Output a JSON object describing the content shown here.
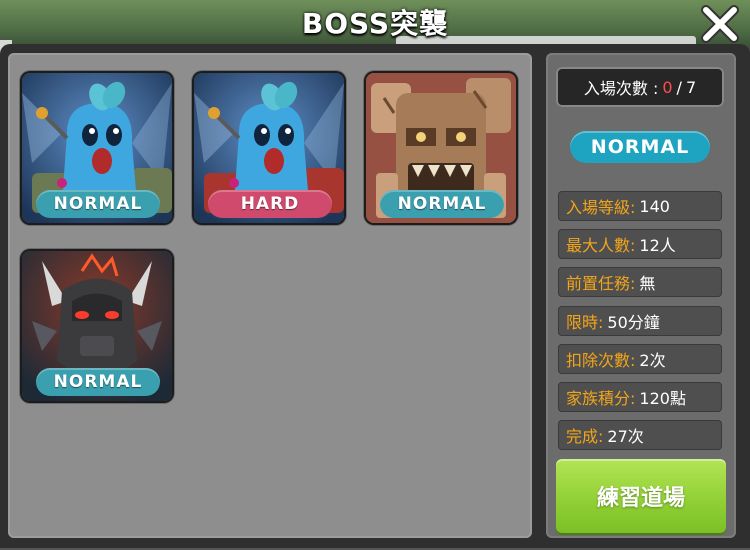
{
  "dialog": {
    "title": "BOSS突襲"
  },
  "bosses": [
    {
      "name_icon": "blue-sprout-boss-icon",
      "difficulty": "NORMAL",
      "badge_color": "#3a9fae"
    },
    {
      "name_icon": "blue-sprout-boss-icon",
      "difficulty": "HARD",
      "badge_color": "#cf4a6c"
    },
    {
      "name_icon": "stone-golem-boss-icon",
      "difficulty": "NORMAL",
      "badge_color": "#3a9fae"
    },
    {
      "name_icon": "dark-horned-beast-boss-icon",
      "difficulty": "NORMAL",
      "badge_color": "#3a9fae"
    }
  ],
  "info": {
    "entry_label": "入場次數 :",
    "entry_current": "0",
    "entry_sep": "/",
    "entry_max": "7",
    "selected_difficulty": "NORMAL",
    "stats": [
      {
        "label": "入場等級:",
        "value": "140"
      },
      {
        "label": "最大人數:",
        "value": "12人"
      },
      {
        "label": "前置任務:",
        "value": "無"
      },
      {
        "label": "限時:",
        "value": "50分鐘"
      },
      {
        "label": "扣除次數:",
        "value": "2次"
      },
      {
        "label": "家族積分:",
        "value": "120點"
      },
      {
        "label": "完成:",
        "value": "27次"
      }
    ],
    "practice_button": "練習道場"
  },
  "colors": {
    "label_orange": "#f2a51a",
    "entry_current_red": "#ff4d4d",
    "normal_teal": "#3a9fae",
    "hard_pink": "#cf4a6c",
    "practice_green": "#8fcf33"
  }
}
